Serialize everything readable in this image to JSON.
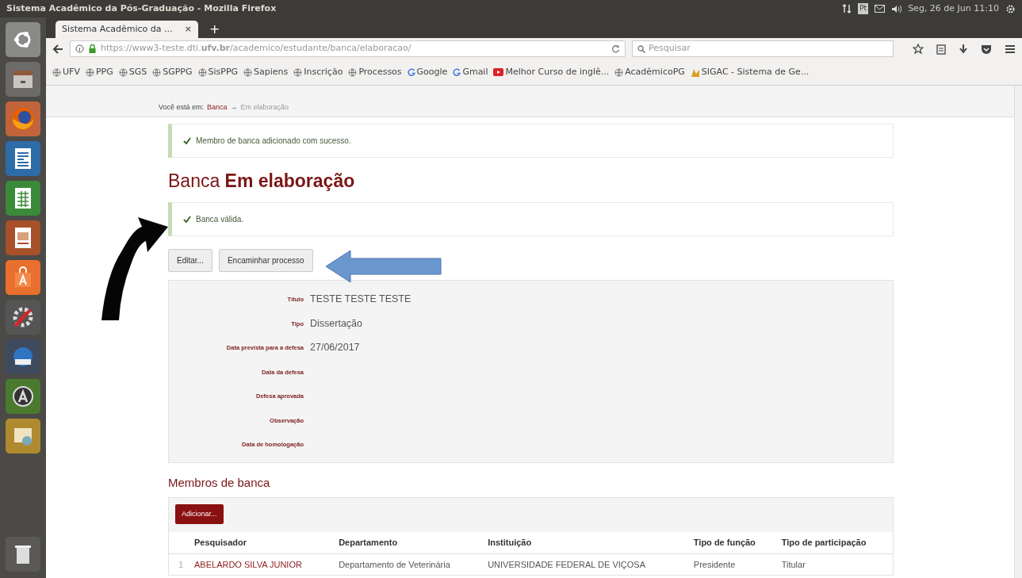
{
  "window": {
    "title": "Sistema Acadêmico da Pós-Graduação - Mozilla Firefox"
  },
  "panel": {
    "clock": "Seg, 26 de Jun 11:10",
    "keyboard": "Pt"
  },
  "browser": {
    "tab_title": "Sistema Acadêmico da ...",
    "close": "×",
    "new_tab": "+",
    "url": "https://www3-teste.dti.**ufv.br**/academico/estudante/banca/elaboracao/",
    "search_placeholder": "Pesquisar",
    "bookmarks": [
      {
        "label": "UFV",
        "kind": "globe"
      },
      {
        "label": "PPG",
        "kind": "globe"
      },
      {
        "label": "SGS",
        "kind": "globe"
      },
      {
        "label": "SGPPG",
        "kind": "globe"
      },
      {
        "label": "SisPPG",
        "kind": "globe"
      },
      {
        "label": "Sapiens",
        "kind": "globe"
      },
      {
        "label": "Inscrição",
        "kind": "globe"
      },
      {
        "label": "Processos",
        "kind": "globe"
      },
      {
        "label": "Google",
        "kind": "google"
      },
      {
        "label": "Gmail",
        "kind": "google"
      },
      {
        "label": "Melhor Curso de inglê...",
        "kind": "video"
      },
      {
        "label": "AcadêmicoPG",
        "kind": "globe"
      },
      {
        "label": "SIGAC - Sistema de Ge...",
        "kind": "sigac"
      }
    ]
  },
  "breadcrumb": {
    "label": "Você está em:",
    "separator": "→",
    "items": [
      {
        "label": "Banca",
        "link": true
      },
      {
        "label": "Em elaboração",
        "link": false
      }
    ]
  },
  "alerts": [
    {
      "text": "Membro de banca adicionado com sucesso."
    }
  ],
  "heading": "Banca **Em elaboração**",
  "status_alert": {
    "text": "Banca válida."
  },
  "actions": [
    "Editar...",
    "Encaminhar processo"
  ],
  "details": [
    {
      "label": "Título",
      "value": "TESTE TESTE TESTE"
    },
    {
      "label": "Tipo",
      "value": "Dissertação"
    },
    {
      "label": "Data prevista para a defesa",
      "value": "27/06/2017"
    },
    {
      "label": "Data da defesa"
    },
    {
      "label": "Defesa aprovada"
    },
    {
      "label": "Observação"
    },
    {
      "label": "Data de homologação"
    }
  ],
  "members": {
    "title": "Membros de banca",
    "add_button": "Adicionar...",
    "columns": [
      "",
      "Pesquisador",
      "Departamento",
      "Instituição",
      "Tipo de função",
      "Tipo de participação"
    ],
    "rows": [
      [
        "1",
        "ABELARDO SILVA JUNIOR",
        "Departamento de Veterinária",
        "UNIVERSIDADE FEDERAL DE VIÇOSA",
        "Presidente",
        "Titular"
      ]
    ]
  }
}
